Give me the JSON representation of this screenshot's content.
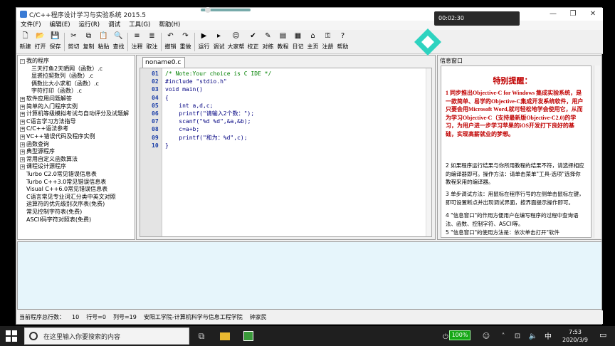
{
  "window": {
    "title": "C/C++程序设计学习与实验系统 2015.5",
    "controls": [
      "—",
      "❐",
      "✕"
    ]
  },
  "menu": [
    "文件(F)",
    "编辑(E)",
    "运行(R)",
    "调试",
    "工具(G)",
    "帮助(H)"
  ],
  "toolbar": [
    {
      "label": "新建",
      "icon": "new-file-icon",
      "glyph": "🗋"
    },
    {
      "label": "打开",
      "icon": "open-folder-icon",
      "glyph": "📂"
    },
    {
      "label": "保存",
      "icon": "save-icon",
      "glyph": "💾"
    },
    {
      "sep": true
    },
    {
      "label": "剪切",
      "icon": "cut-icon",
      "glyph": "✂"
    },
    {
      "label": "复制",
      "icon": "copy-icon",
      "glyph": "⧉"
    },
    {
      "label": "粘贴",
      "icon": "paste-icon",
      "glyph": "📋"
    },
    {
      "label": "查找",
      "icon": "find-icon",
      "glyph": "🔍"
    },
    {
      "sep": true
    },
    {
      "label": "注释",
      "icon": "comment-icon",
      "glyph": "≡"
    },
    {
      "label": "取注",
      "icon": "uncomment-icon",
      "glyph": "≣"
    },
    {
      "sep": true
    },
    {
      "label": "撤销",
      "icon": "undo-icon",
      "glyph": "↶"
    },
    {
      "label": "重做",
      "icon": "redo-icon",
      "glyph": "↷"
    },
    {
      "sep": true
    },
    {
      "label": "运行",
      "icon": "run-icon",
      "glyph": "▶"
    },
    {
      "label": "调试",
      "icon": "debug-icon",
      "glyph": "▸"
    },
    {
      "label": "大家帮",
      "icon": "people-icon",
      "glyph": "☺"
    },
    {
      "label": "校正",
      "icon": "check-icon",
      "glyph": "✔"
    },
    {
      "label": "对练",
      "icon": "practice-icon",
      "glyph": "✎"
    },
    {
      "label": "教程",
      "icon": "tutorial-icon",
      "glyph": "▤"
    },
    {
      "label": "日记",
      "icon": "diary-icon",
      "glyph": "▦"
    },
    {
      "label": "主页",
      "icon": "home-icon",
      "glyph": "⌂"
    },
    {
      "label": "注册",
      "icon": "register-icon",
      "glyph": "⚿"
    },
    {
      "label": "帮助",
      "icon": "help-icon",
      "glyph": "?"
    }
  ],
  "tree": [
    {
      "text": "我的程序",
      "level": 0,
      "toggle": "-"
    },
    {
      "text": "三天打鱼2天晒网（函数）.c",
      "level": 1
    },
    {
      "text": "显裘拉契数列（函数）.c",
      "level": 1
    },
    {
      "text": "俩数比大小求和（函数）.c",
      "level": 1
    },
    {
      "text": "字符打印（函数）.c",
      "level": 1
    },
    {
      "text": "软件应用问题解答",
      "level": 0,
      "toggle": "+"
    },
    {
      "text": "简单的入门程序实例",
      "level": 0,
      "toggle": "+"
    },
    {
      "text": "计算机等级模拟考试与自动评分及试题解",
      "level": 0,
      "toggle": "+"
    },
    {
      "text": "C语言学习方法指导",
      "level": 0,
      "toggle": "+"
    },
    {
      "text": "C/C++语法参考",
      "level": 0,
      "toggle": "+"
    },
    {
      "text": "VC++错误代码及程序实例",
      "level": 0,
      "toggle": "+"
    },
    {
      "text": "函数查询",
      "level": 0,
      "toggle": "+"
    },
    {
      "text": "典型源程序",
      "level": 0,
      "toggle": "+"
    },
    {
      "text": "常用自定义函数算法",
      "level": 0,
      "toggle": "+"
    },
    {
      "text": "课程设计源程序",
      "level": 0,
      "toggle": "+"
    },
    {
      "text": "Turbo C2.0常见错误信息表",
      "level": 0
    },
    {
      "text": "Turbo C++3.0常见错误信息表",
      "level": 0
    },
    {
      "text": "Visual C++6.0常见错误信息表",
      "level": 0
    },
    {
      "text": "C语言常见专业词汇分类中英文对照",
      "level": 0
    },
    {
      "text": "运算符的优先级别次序表(免费)",
      "level": 0
    },
    {
      "text": "常见控制字符表(免费)",
      "level": 0
    },
    {
      "text": "ASCII码字符对照表(免费)",
      "level": 0
    }
  ],
  "editor": {
    "tab": "noname0.c",
    "lines": [
      {
        "n": "01",
        "code": "/* Note:Your choice is C IDE */"
      },
      {
        "n": "02",
        "code": "#include \"stdio.h\""
      },
      {
        "n": "03",
        "code": "void main()"
      },
      {
        "n": "04",
        "code": "{"
      },
      {
        "n": "05",
        "code": "    int a,d,c;"
      },
      {
        "n": "06",
        "code": "    printf(\"请输入2个数：\");"
      },
      {
        "n": "07",
        "code": "    scanf(\"%d %d\",&a,&b);"
      },
      {
        "n": "08",
        "code": "    c=a+b;"
      },
      {
        "n": "09",
        "code": "    printf(\"和为：%d\",c);"
      },
      {
        "n": "10",
        "code": "}"
      }
    ]
  },
  "info": {
    "title": "信息窗口",
    "heading": "特别提醒：",
    "paragraphs": [
      {
        "text": "1 同步推出Objective-C for Windows 集成实验系统，是一款简单、易学的Objective-C集成开发系统软件，用户只要会用Microsoft Word,就可轻松地学会使用它，从而为学习Objective-C（支持最新版Objective-C2.0)的学习，为用户进一步学习苹果的iOS开发打下良好的基础，实现高薪就业的梦想。",
        "red": true
      },
      {
        "text": "2 如果程序运行结果与你所用教程的结果不符，请选择相应的编译器即可。操作方法：请单击菜单\"工具-选项\"选择你教程采用的编译器。",
        "red": false
      },
      {
        "text": "3 单步调试方法：用鼠标在程序行号的左侧单击鼠标左键，即可设置断点并出现调试界面，按界面提示操作即可。",
        "red": false
      },
      {
        "text": "4 \"信息窗口\"的作用方便用户在编写程序的过程中查询语法、函数、控制字符、ASCII等。",
        "red": false
      },
      {
        "text": "5 \"信息窗口\"的使用方法是：依次单击打开\"软件",
        "red": false
      }
    ]
  },
  "status": {
    "total_lines_label": "当前程序总行数：",
    "total_lines": "10",
    "row": "行号=0",
    "col": "列号=19",
    "org": "安阳工学院-计算机科学与信息工程学院",
    "author": "钟家民"
  },
  "overlay": {
    "video_time": "00:02:30",
    "progress": 0.1
  },
  "taskbar": {
    "search_placeholder": "在这里输入你要搜索的内容",
    "battery": "100%",
    "time": "7:53",
    "date": "2020/3/9",
    "ime": "中"
  }
}
